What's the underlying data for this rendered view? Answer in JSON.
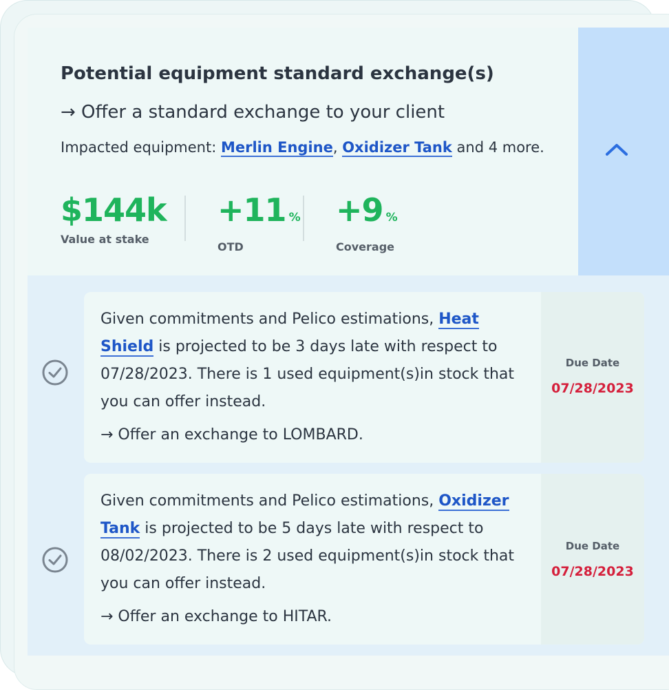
{
  "header": {
    "title": "Potential equipment standard exchange(s)",
    "cta": "→ Offer a standard exchange to your client",
    "impacted_prefix": "Impacted equipment: ",
    "impacted_links": [
      "Merlin Engine",
      "Oxidizer Tank"
    ],
    "impacted_separator": ", ",
    "impacted_suffix": " and 4 more.",
    "toggle_icon": "chevron-up-icon"
  },
  "metrics": [
    {
      "value": "$144k",
      "unit": "",
      "label": "Value at stake"
    },
    {
      "value": "+11",
      "unit": "%",
      "label": "OTD"
    },
    {
      "value": "+9",
      "unit": "%",
      "label": "Coverage"
    }
  ],
  "rows": [
    {
      "text_before": "Given commitments and Pelico estimations, ",
      "equipment": "Heat Shield",
      "text_after": " is projected to be 3 days late with respect to 07/28/2023. There is 1 used equipment(s)in stock that you can offer instead.",
      "action": "→ Offer an exchange to LOMBARD.",
      "due_label": "Due Date",
      "due_date": "07/28/2023",
      "status_icon": "check-circle-icon"
    },
    {
      "text_before": "Given commitments and Pelico estimations, ",
      "equipment": "Oxidizer Tank",
      "text_after": " is projected to be 5 days late with respect to 08/02/2023. There is 2 used equipment(s)in stock that you can offer instead.",
      "action": "→ Offer an exchange to HITAR.",
      "due_label": "Due Date",
      "due_date": "07/28/2023",
      "status_icon": "check-circle-icon"
    }
  ],
  "colors": {
    "accent_green": "#1fb45c",
    "link_blue": "#1e56c7",
    "due_red": "#d51f3b",
    "panel_blue": "#c3dffb"
  }
}
